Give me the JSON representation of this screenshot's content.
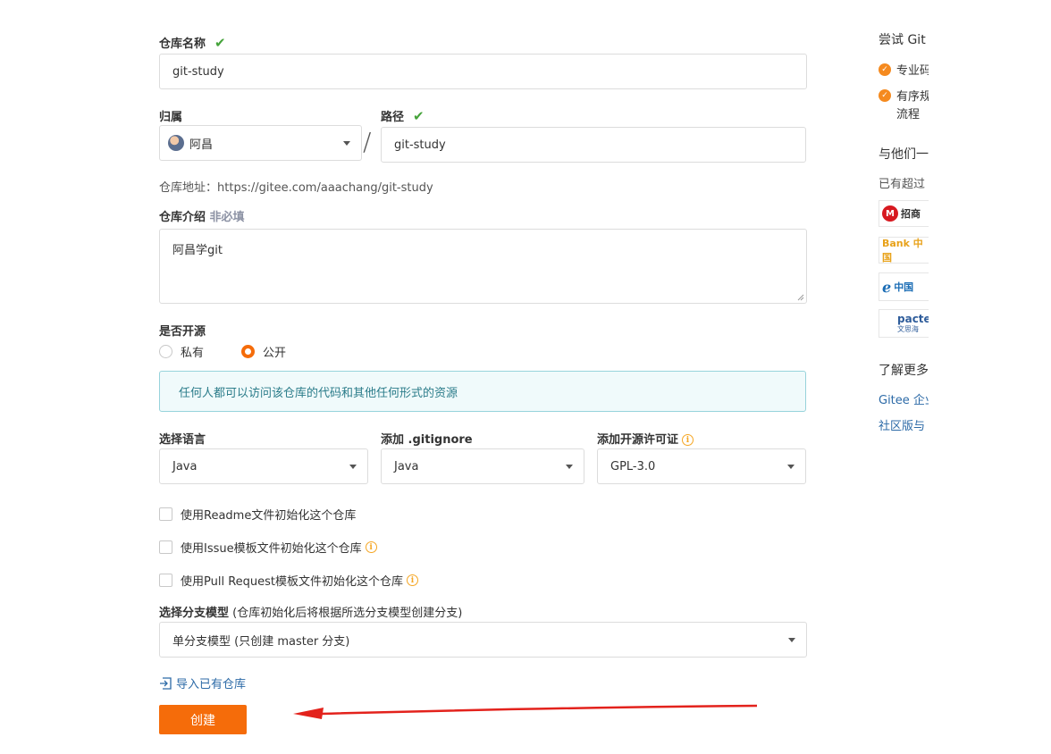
{
  "form": {
    "repo_name_label": "仓库名称",
    "repo_name_value": "git-study",
    "owner_label": "归属",
    "owner_value": "阿昌",
    "path_label": "路径",
    "path_value": "git-study",
    "slash": "/",
    "repo_url_prefix": "仓库地址：",
    "repo_url": "https://gitee.com/aaachang/git-study",
    "description_label": "仓库介绍",
    "description_optional": "非必填",
    "description_value": "阿昌学git",
    "opensource_label": "是否开源",
    "private_label": "私有",
    "public_label": "公开",
    "public_notice": "任何人都可以访问该仓库的代码和其他任何形式的资源",
    "language_label": "选择语言",
    "language_value": "Java",
    "gitignore_label": "添加 .gitignore",
    "gitignore_value": "Java",
    "license_label": "添加开源许可证",
    "license_value": "GPL-3.0",
    "init_readme": "使用Readme文件初始化这个仓库",
    "init_issue": "使用Issue模板文件初始化这个仓库",
    "init_pr": "使用Pull Request模板文件初始化这个仓库",
    "branch_model_label": "选择分支模型",
    "branch_model_hint": "(仓库初始化后将根据所选分支模型创建分支)",
    "branch_model_value": "单分支模型 (只创建 master 分支)",
    "import_link": "导入已有仓库",
    "create_button": "创建"
  },
  "sidebar": {
    "try_title": "尝试 Git",
    "feature_1": "专业码",
    "feature_2a": "有序规",
    "feature_2b": "流程",
    "join_title": "与他们一",
    "already_text": "已有超过",
    "logo_1": "招商",
    "logo_2": "Bank 中国",
    "logo_3": "中国",
    "logo_4a": "pacte",
    "logo_4b": "文思海",
    "learn_more": "了解更多",
    "link_1": "Gitee 企业",
    "link_2": "社区版与"
  },
  "colors": {
    "accent": "#f56c0a",
    "check_green": "#45a33a",
    "notice_bg": "#f0fafb",
    "notice_border": "#97d3db",
    "link": "#2c6aa7",
    "annotation_arrow": "#e3221c"
  }
}
